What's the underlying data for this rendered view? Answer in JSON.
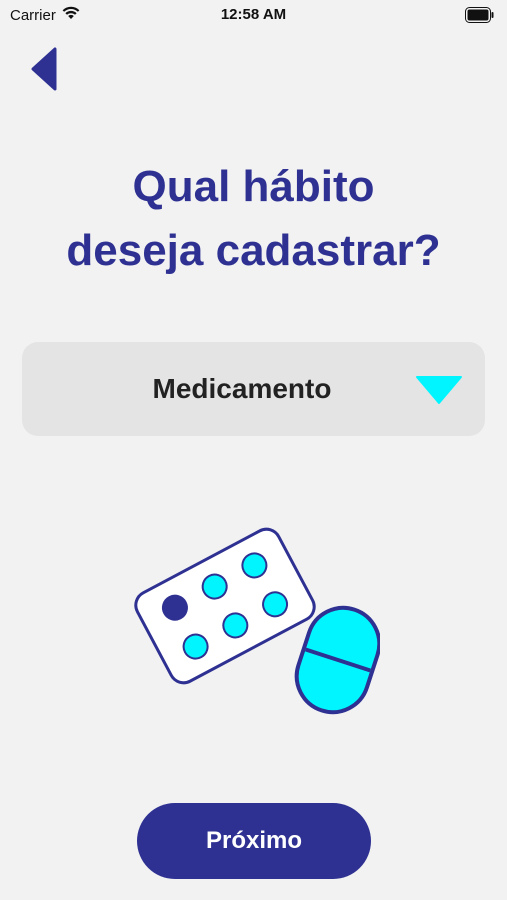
{
  "status_bar": {
    "carrier": "Carrier",
    "time": "12:58 AM",
    "wifi_icon": "wifi-icon",
    "battery_icon": "battery-icon"
  },
  "nav": {
    "back_icon": "chevron-left-icon"
  },
  "title": "Qual hábito\ndeseja cadastrar?",
  "habit_select": {
    "selected": "Medicamento",
    "dropdown_icon": "triangle-down-icon"
  },
  "illustration": {
    "icon": "pills-icon"
  },
  "next_button": {
    "label": "Próximo"
  },
  "colors": {
    "primary": "#2e3192",
    "accent": "#00f5ff",
    "background": "#f2f2f2",
    "select_background": "#e4e4e4"
  }
}
